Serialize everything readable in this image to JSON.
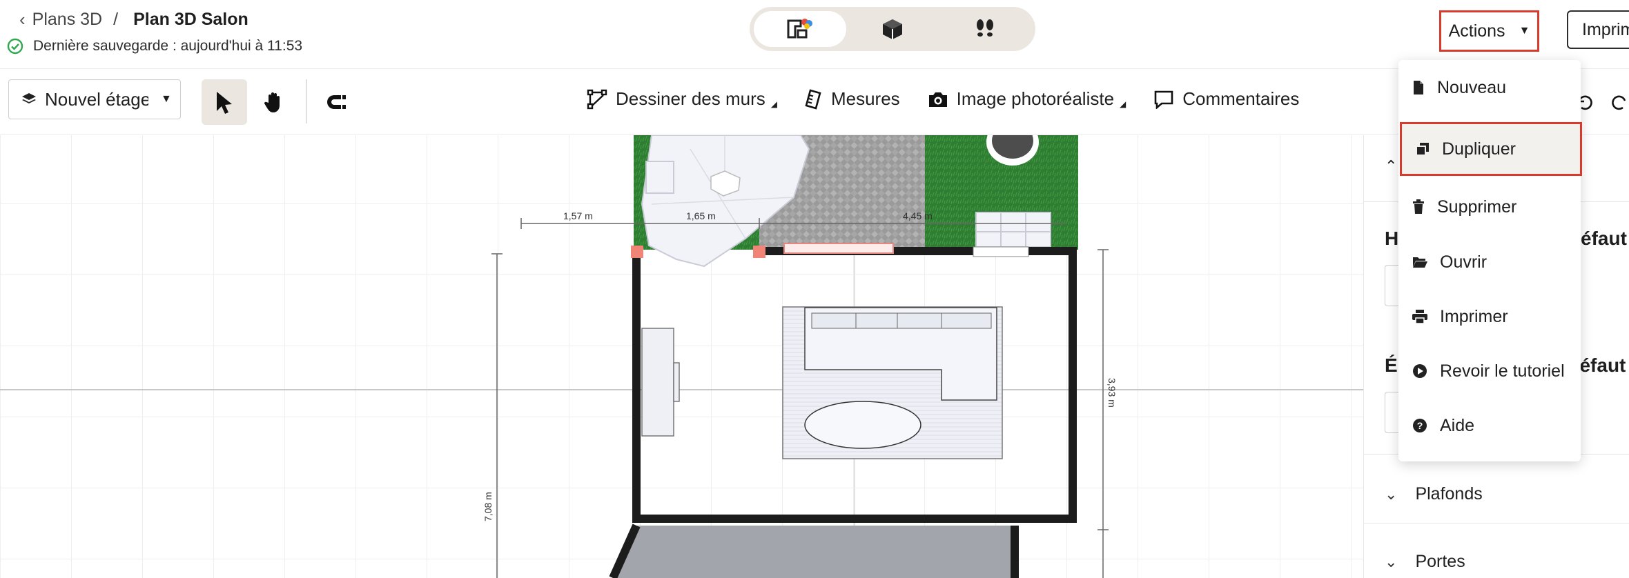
{
  "breadcrumb": {
    "parent": "Plans 3D",
    "separator": "/",
    "current": "Plan 3D Salon"
  },
  "save_status": "Dernière sauvegarde : aujourd'hui à 11:53",
  "view_modes": [
    "2d-plan-icon",
    "3d-box-icon",
    "footsteps-icon"
  ],
  "actions_label": "Actions",
  "print_label": "Imprimer",
  "level_select": {
    "label": "Nouvel étage"
  },
  "tools": {
    "draw_walls": "Dessiner des murs",
    "measures": "Mesures",
    "photo_image": "Image photoréaliste",
    "comments": "Commentaires"
  },
  "actions_menu": [
    {
      "label": "Nouveau",
      "icon": "file-icon"
    },
    {
      "label": "Dupliquer",
      "icon": "copy-icon"
    },
    {
      "label": "Supprimer",
      "icon": "trash-icon"
    },
    {
      "label": "Ouvrir",
      "icon": "folder-open-icon"
    },
    {
      "label": "Imprimer",
      "icon": "print-icon"
    },
    {
      "label": "Revoir le tutoriel",
      "icon": "play-circle-icon"
    },
    {
      "label": "Aide",
      "icon": "help-circle-icon"
    }
  ],
  "side_panel": {
    "height_default_partial": "H",
    "height_default_suffix": "éfaut",
    "thickness_default_partial": "É",
    "thickness_default_suffix": "éfaut",
    "ceilings": "Plafonds",
    "doors": "Portes"
  },
  "dimensions": {
    "d1": "1,57 m",
    "d2": "1,65 m",
    "d3": "4,45 m",
    "d4": "3,93 m",
    "d5": "7,08 m"
  },
  "colors": {
    "accent_red": "#d93a2b",
    "grass": "#2f7d32",
    "wall": "#1c1c1c",
    "selected_bg": "#ebe7e0"
  }
}
